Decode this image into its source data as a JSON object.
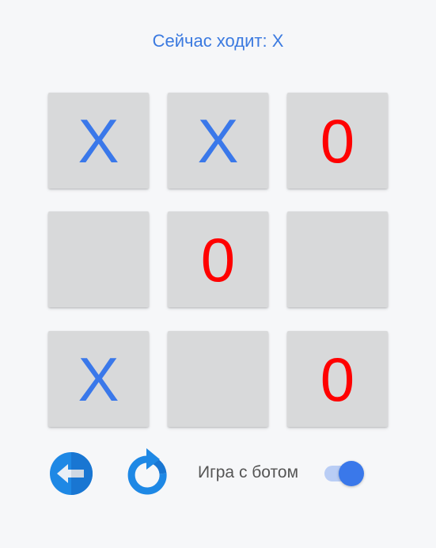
{
  "status": {
    "text": "Сейчас ходит: X"
  },
  "board": {
    "cells": [
      "X",
      "X",
      "0",
      "",
      "0",
      "",
      "X",
      "",
      "0"
    ]
  },
  "controls": {
    "back_icon": "back-arrow-icon",
    "restart_icon": "restart-icon",
    "bot_label": "Игра с ботом",
    "bot_toggle_on": true
  },
  "colors": {
    "x": "#3a78ea",
    "o": "#ff0000",
    "accent": "#3b7ae0"
  }
}
